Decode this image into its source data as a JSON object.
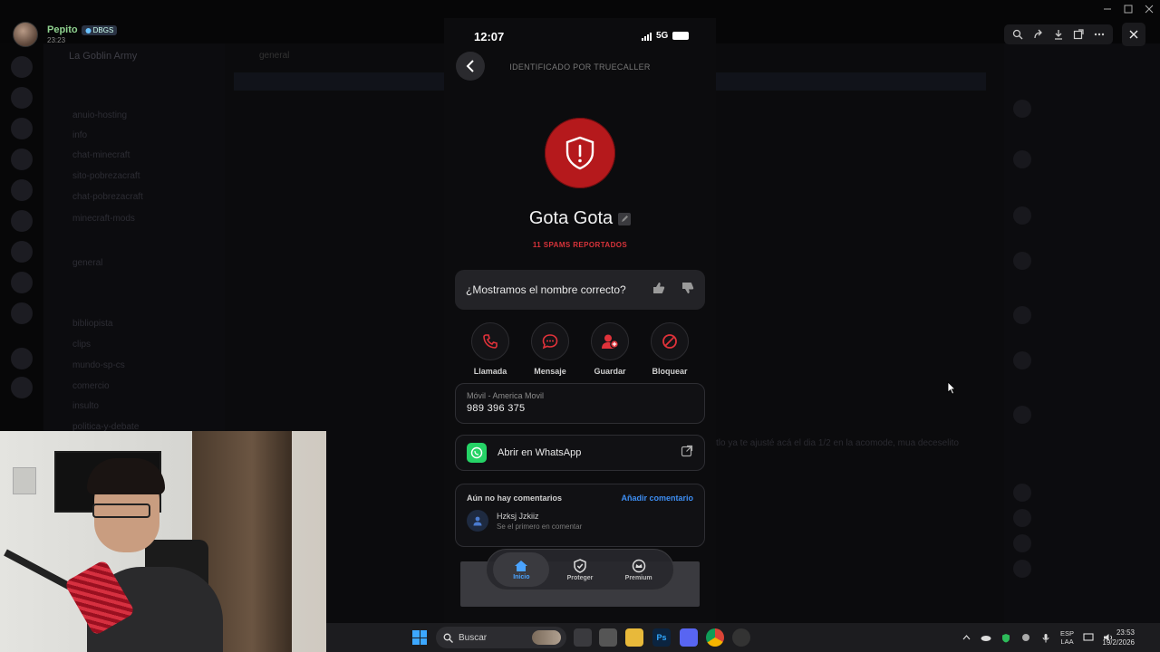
{
  "app": {
    "background_title": "La Goblin Army",
    "user": {
      "name": "Pepito",
      "tag": "DBGS",
      "time": "23:23"
    }
  },
  "background": {
    "channels": [
      "anuio-hosting",
      "info",
      "chat-minecraft",
      "sito-pobrezacraft",
      "chat-pobrezacraft",
      "minecraft-mods",
      "general",
      "bibliopista",
      "clips",
      "mundo-sp-cs",
      "comercio",
      "insulto",
      "politica-y-debate"
    ],
    "chat_header": "general",
    "chat_snippet": "tlo ya te ajusté acá el dia 1/2 en la acomode, mua deceselito"
  },
  "phone": {
    "status": {
      "time": "12:07",
      "network": "5G"
    },
    "header": "IDENTIFICADO POR TRUECALLER",
    "caller_name": "Gota Gota",
    "spam_count": "11 SPAMS REPORTADOS",
    "name_question": "¿Mostramos el nombre correcto?",
    "actions": [
      {
        "label": "Llamada",
        "icon": "phone-icon"
      },
      {
        "label": "Mensaje",
        "icon": "message-icon"
      },
      {
        "label": "Guardar",
        "icon": "add-contact-icon"
      },
      {
        "label": "Bloquear",
        "icon": "block-icon"
      }
    ],
    "number": {
      "label": "Móvil - America Movil",
      "value": "989 396 375"
    },
    "whatsapp": {
      "label": "Abrir en WhatsApp"
    },
    "comments": {
      "empty": "Aún no hay comentarios",
      "add": "Añadir comentario",
      "user": "Hzksj Jzkiiz",
      "sub": "Se el primero en comentar"
    },
    "nav": [
      {
        "label": "Inicio",
        "icon": "home-icon",
        "active": true
      },
      {
        "label": "Proteger",
        "icon": "shield-check-icon",
        "active": false
      },
      {
        "label": "Premium",
        "icon": "premium-icon",
        "active": false
      }
    ]
  },
  "taskbar": {
    "search_placeholder": "Buscar",
    "lang": [
      "ESP",
      "LAA"
    ],
    "time": "23:53",
    "date": "19/2/2026"
  },
  "colors": {
    "accent_red": "#b5191c",
    "spam_red": "#d8333a",
    "link_blue": "#3d8ef3",
    "whatsapp": "#25d366"
  }
}
